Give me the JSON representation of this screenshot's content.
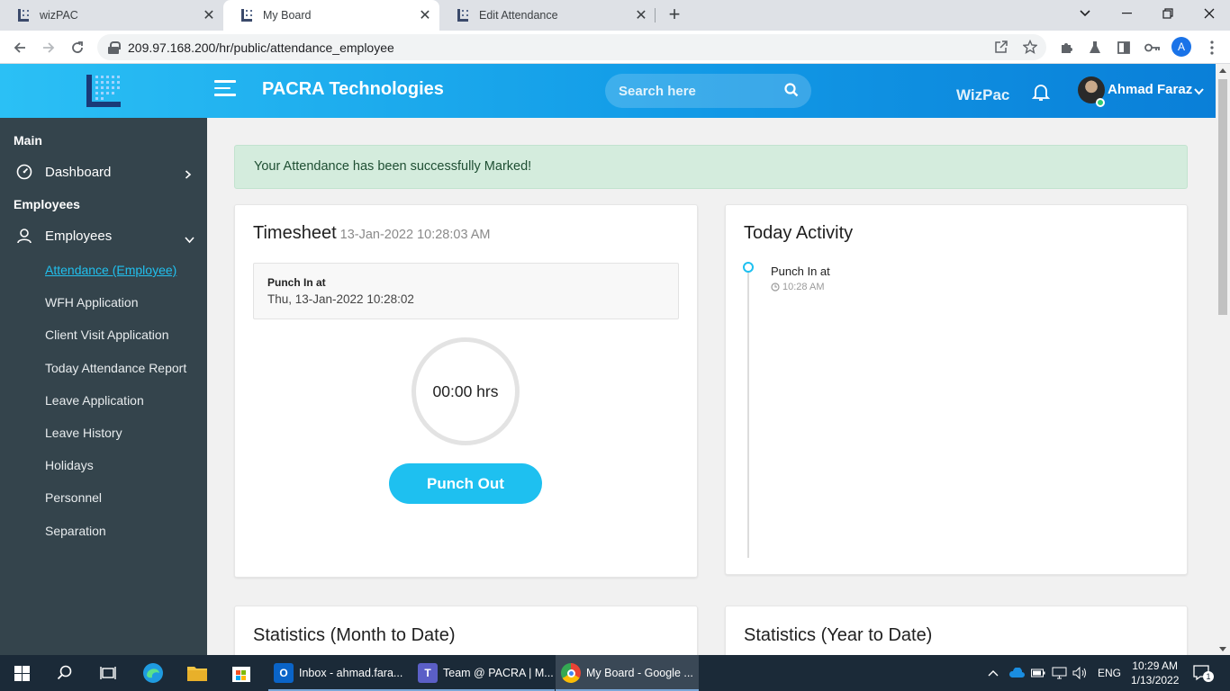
{
  "browser": {
    "tabs": [
      {
        "title": "wizPAC"
      },
      {
        "title": "My Board"
      },
      {
        "title": "Edit Attendance"
      }
    ],
    "url": "209.97.168.200/hr/public/attendance_employee",
    "profile_initial": "A"
  },
  "header": {
    "brand": "PACRA Technologies",
    "search_placeholder": "Search here",
    "wizpac_label": "WizPac",
    "username": "Ahmad Faraz"
  },
  "sidebar": {
    "section_main": "Main",
    "dashboard": "Dashboard",
    "section_employees": "Employees",
    "employees": "Employees",
    "submenu": [
      {
        "label": "Attendance (Employee)"
      },
      {
        "label": "WFH Application"
      },
      {
        "label": "Client Visit Application"
      },
      {
        "label": "Today Attendance Report"
      },
      {
        "label": "Leave Application"
      },
      {
        "label": "Leave History"
      },
      {
        "label": "Holidays"
      },
      {
        "label": "Personnel"
      },
      {
        "label": "Separation"
      }
    ]
  },
  "alert": {
    "message": "Your Attendance has been successfully Marked!"
  },
  "timesheet": {
    "title": "Timesheet",
    "datetime": "13-Jan-2022 10:28:03 AM",
    "punch_label": "Punch In at",
    "punch_value": "Thu, 13-Jan-2022 10:28:02",
    "hours": "00:00 hrs",
    "button": "Punch Out"
  },
  "activity": {
    "title": "Today Activity",
    "items": [
      {
        "label": "Punch In at",
        "time": "10:28 AM"
      }
    ]
  },
  "stats": {
    "month_title": "Statistics (Month to Date)",
    "year_title": "Statistics (Year to Date)"
  },
  "taskbar": {
    "apps": [
      {
        "label": "Inbox - ahmad.fara..."
      },
      {
        "label": "Team @ PACRA | M..."
      },
      {
        "label": "My Board - Google ..."
      }
    ],
    "lang": "ENG",
    "time": "10:29 AM",
    "date": "1/13/2022",
    "notifications": "1"
  },
  "colors": {
    "accent": "#1ec0f0",
    "sidebar_bg": "#34444c",
    "header_start": "#2bc0f5",
    "header_end": "#0a7fd8",
    "alert_bg": "#d4ecdd"
  }
}
